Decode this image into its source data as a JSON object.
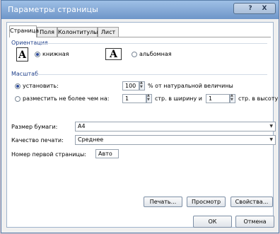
{
  "window": {
    "title": "Параметры страницы",
    "help": "?",
    "close": "X"
  },
  "tabs": [
    "Страница",
    "Поля",
    "Колонтитулы",
    "Лист"
  ],
  "orientation": {
    "heading": "Ориентация",
    "portrait_label": "книжная",
    "landscape_label": "альбомная",
    "icon_letter": "A",
    "selected": "portrait"
  },
  "scale": {
    "heading": "Масштаб",
    "set_label": "установить:",
    "set_value": "100",
    "set_suffix": "% от натуральной величины",
    "fit_label": "разместить не более чем на:",
    "fit_width_value": "1",
    "fit_width_suffix": "стр. в ширину и",
    "fit_height_value": "1",
    "fit_height_suffix": "стр. в высоту"
  },
  "paper": {
    "size_label": "Размер бумаги:",
    "size_value": "A4",
    "quality_label": "Качество печати:",
    "quality_value": "Среднее",
    "first_page_label": "Номер первой страницы:",
    "first_page_value": "Авто"
  },
  "buttons": {
    "print": "Печать...",
    "preview": "Просмотр",
    "properties": "Свойства...",
    "ok": "ОК",
    "cancel": "Отмена"
  },
  "colors": {
    "accent": "#1e3f8a",
    "titlebar": "#6e95c8"
  }
}
